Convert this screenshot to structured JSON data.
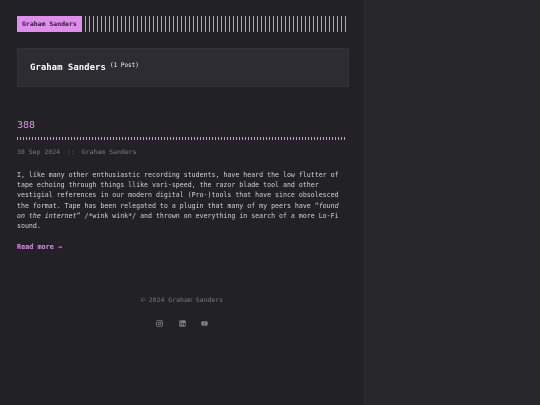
{
  "site": {
    "logo_text": "Graham Sanders"
  },
  "author_box": {
    "name": "Graham Sanders",
    "post_count": "(1 Post)"
  },
  "post": {
    "title": "388",
    "date": "30 Sep 2024",
    "separator": "::",
    "author": "Graham Sanders",
    "body_p1": "I, like many other enthusiastic recording students, have heard the low flutter of tape echoing through things llike vari-speed, the razor blade tool and other vestigial references in our modern digital (Pro-)tools that have since obsolesced the format. Tape has been relegated to a plugin that many of my peers have “",
    "body_em": "found on the internet",
    "body_p2": "” /*wink wink*/ and thrown on everything in search of a more Lo-Fi sound.",
    "read_more": "Read more →"
  },
  "footer": {
    "copyright": "© 2024 Graham Sanders",
    "social_icons": [
      "instagram-icon",
      "linkedin-icon",
      "youtube-icon"
    ]
  },
  "colors": {
    "accent": "#e28cf0",
    "background": "#222126",
    "panel": "#2d2c32"
  }
}
